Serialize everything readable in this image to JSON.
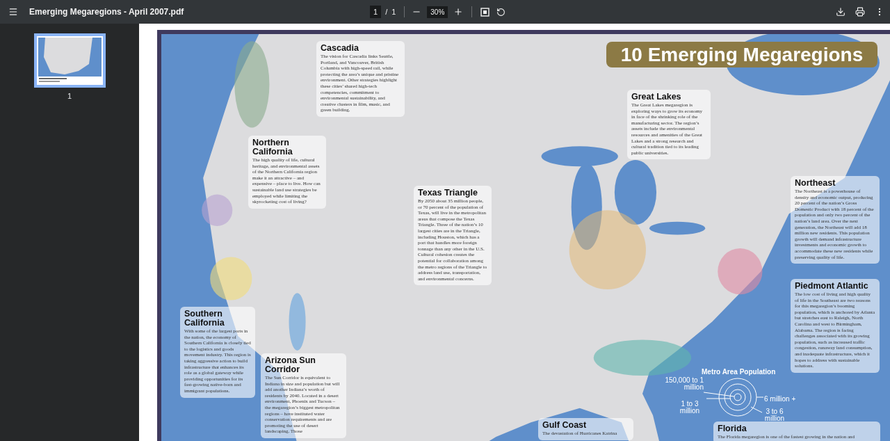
{
  "toolbar": {
    "title": "Emerging Megaregions - April 2007.pdf",
    "page_input": "1",
    "page_separator": "/",
    "page_count": "1",
    "zoom": "30%"
  },
  "sidebar": {
    "thumbnails": [
      {
        "label": "1",
        "selected": true
      }
    ]
  },
  "document": {
    "banner": "10 Emerging Megaregions",
    "regions": [
      {
        "title": "Cascadia",
        "text": "The vision for Cascadia links Seattle, Portland, and Vancouver, British Columbia with high-speed rail, while protecting the area’s unique and pristine environment. Other strategies highlight these cities’ shared high-tech competencies, commitment to environmental sustainability, and creative clusters in film, music, and green building."
      },
      {
        "title": "Northern California",
        "text": "The high quality of life, cultural heritage, and environmental assets of the Northern California region make it an attractive – and expensive – place to live. How can sustainable land use strategies be employed while limiting the skyrocketing cost of living?"
      },
      {
        "title": "Texas Triangle",
        "text": "By 2050 about 35 million people, or 70 percent of the population of Texas, will live in the metropolitan areas that compose the Texas Triangle. Three of the nation’s 10 largest cities are in the Triangle, including Houston, which has a port that handles more foreign tonnage than any other in the U.S. Cultural cohesion creates the potential for collaboration among the metro regions of the Triangle to address land use, transportation, and environmental concerns."
      },
      {
        "title": "Great Lakes",
        "text": "The Great Lakes megaregion is exploring ways to grow its economy in face of the shrinking role of the manufacturing sector. The region’s assets include the environmental resources and amenities of the Great Lakes and a strong research and cultural tradition tied to its leading public universities."
      },
      {
        "title": "Northeast",
        "text": "The Northeast is a powerhouse of density and economic output, producing 20 percent of the nation’s Gross Domestic Product with 18 percent of the population and only two percent of the nation’s land area. Over the next generation, the Northeast will add 18 million new residents. This population growth will demand infrastructure investments and economic growth to accommodate these new residents while preserving quality of life."
      },
      {
        "title": "Piedmont Atlantic",
        "text": "The low cost of living and high quality of life in the Southeast are two reasons for this megaregion’s booming population, which is anchored by Atlanta but stretches east to Raleigh, North Carolina and west to Birmingham, Alabama. The region is facing challenges associated with its growing population, such as increased traffic congestion, runaway land consumption, and inadequate infrastructure, which it hopes to address with sustainable solutions."
      },
      {
        "title": "Southern California",
        "text": "With some of the largest ports in the nation, the economy of Southern California is closely tied to the logistics and goods movement industry. This region is taking aggressive action to build infrastructure that enhances its role as a global gateway while providing opportunities for its fast-growing native-born and immigrant populations."
      },
      {
        "title": "Arizona Sun Corridor",
        "text": "The Sun Corridor is equivalent to Indiana in size and population but will add another Indiana’s worth of residents by 2040. Located in a desert environment, Phoenix and Tucson – the megaregion’s biggest metropolitan regions – have instituted water conservation requirements and are promoting the use of desert landscaping. Those"
      },
      {
        "title": "Gulf Coast",
        "text": "The devastation of Hurricanes Katrina"
      },
      {
        "title": "Florida",
        "text": "The Florida megaregion is one of the fastest growing in the nation and"
      }
    ],
    "legend": {
      "title": "Metro Area Population",
      "labels": [
        "150,000 to 1 million",
        "1 to 3 million",
        "6 million +",
        "3 to 6 million"
      ]
    }
  }
}
